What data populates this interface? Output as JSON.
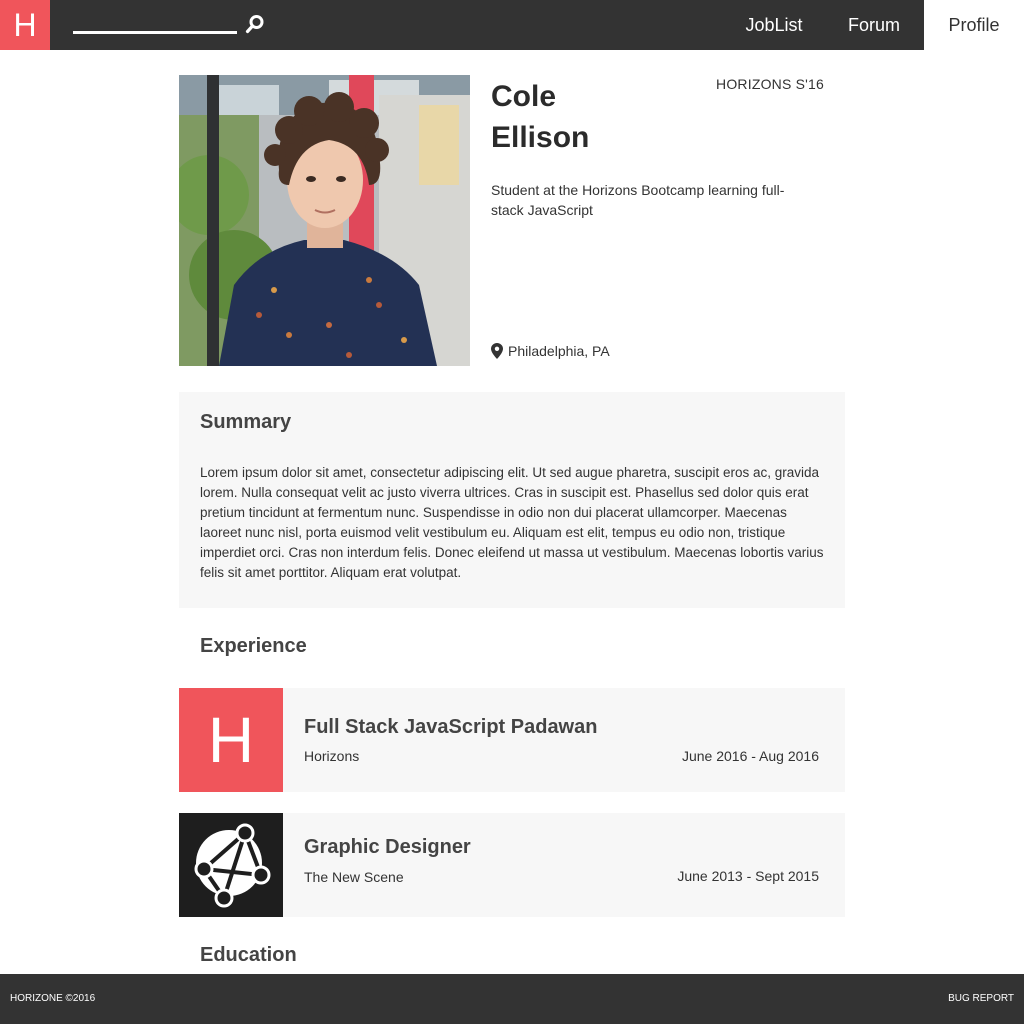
{
  "nav": {
    "logo_letter": "H",
    "search_value": "",
    "items": [
      {
        "label": "JobList",
        "active": false
      },
      {
        "label": "Forum",
        "active": false
      },
      {
        "label": "Profile",
        "active": true
      }
    ]
  },
  "profile": {
    "first_name": "Cole",
    "last_name": "Ellison",
    "cohort": "HORIZONS S'16",
    "tagline": "Student at the Horizons Bootcamp learning full-stack JavaScript",
    "location": "Philadelphia, PA",
    "location_icon": "map-pin-icon"
  },
  "summary": {
    "title": "Summary",
    "text": "Lorem ipsum dolor sit amet, consectetur adipiscing elit. Ut sed augue pharetra, suscipit eros ac, gravida lorem. Nulla consequat velit ac justo viverra ultrices. Cras in suscipit est. Phasellus sed dolor quis erat pretium tincidunt at fermentum nunc. Suspendisse in odio non dui placerat ullamcorper. Maecenas laoreet nunc nisl, porta euismod velit vestibulum eu. Aliquam est elit, tempus eu odio non, tristique imperdiet orci. Cras non interdum felis. Donec eleifend ut massa ut vestibulum. Maecenas lobortis varius felis sit amet porttitor. Aliquam erat volutpat."
  },
  "experience": {
    "title": "Experience",
    "items": [
      {
        "role": "Full Stack JavaScript Padawan",
        "company": "Horizons",
        "dates": "June 2016 - Aug 2016",
        "logo_letter": "H"
      },
      {
        "role": "Graphic Designer",
        "company": "The New Scene",
        "dates": "June 2013 - Sept 2015",
        "logo_icon": "network-globe-icon"
      }
    ]
  },
  "education": {
    "title": "Education"
  },
  "footer": {
    "copyright": "HORIZONE ©2016",
    "bug_report": "BUG REPORT"
  },
  "colors": {
    "brand": "#f0555b",
    "nav_bg": "#333333",
    "card_bg": "#f7f7f7"
  }
}
